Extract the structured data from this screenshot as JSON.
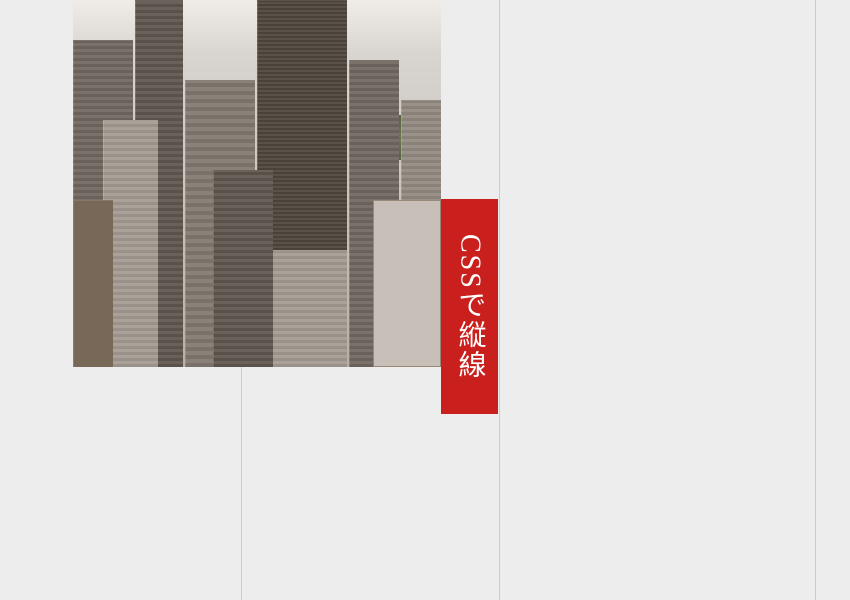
{
  "label": {
    "text": "CSSで縦線",
    "background_color": "#c9201d",
    "text_color": "#ffffff"
  },
  "image": {
    "description": "cityscape-aerial-view"
  }
}
